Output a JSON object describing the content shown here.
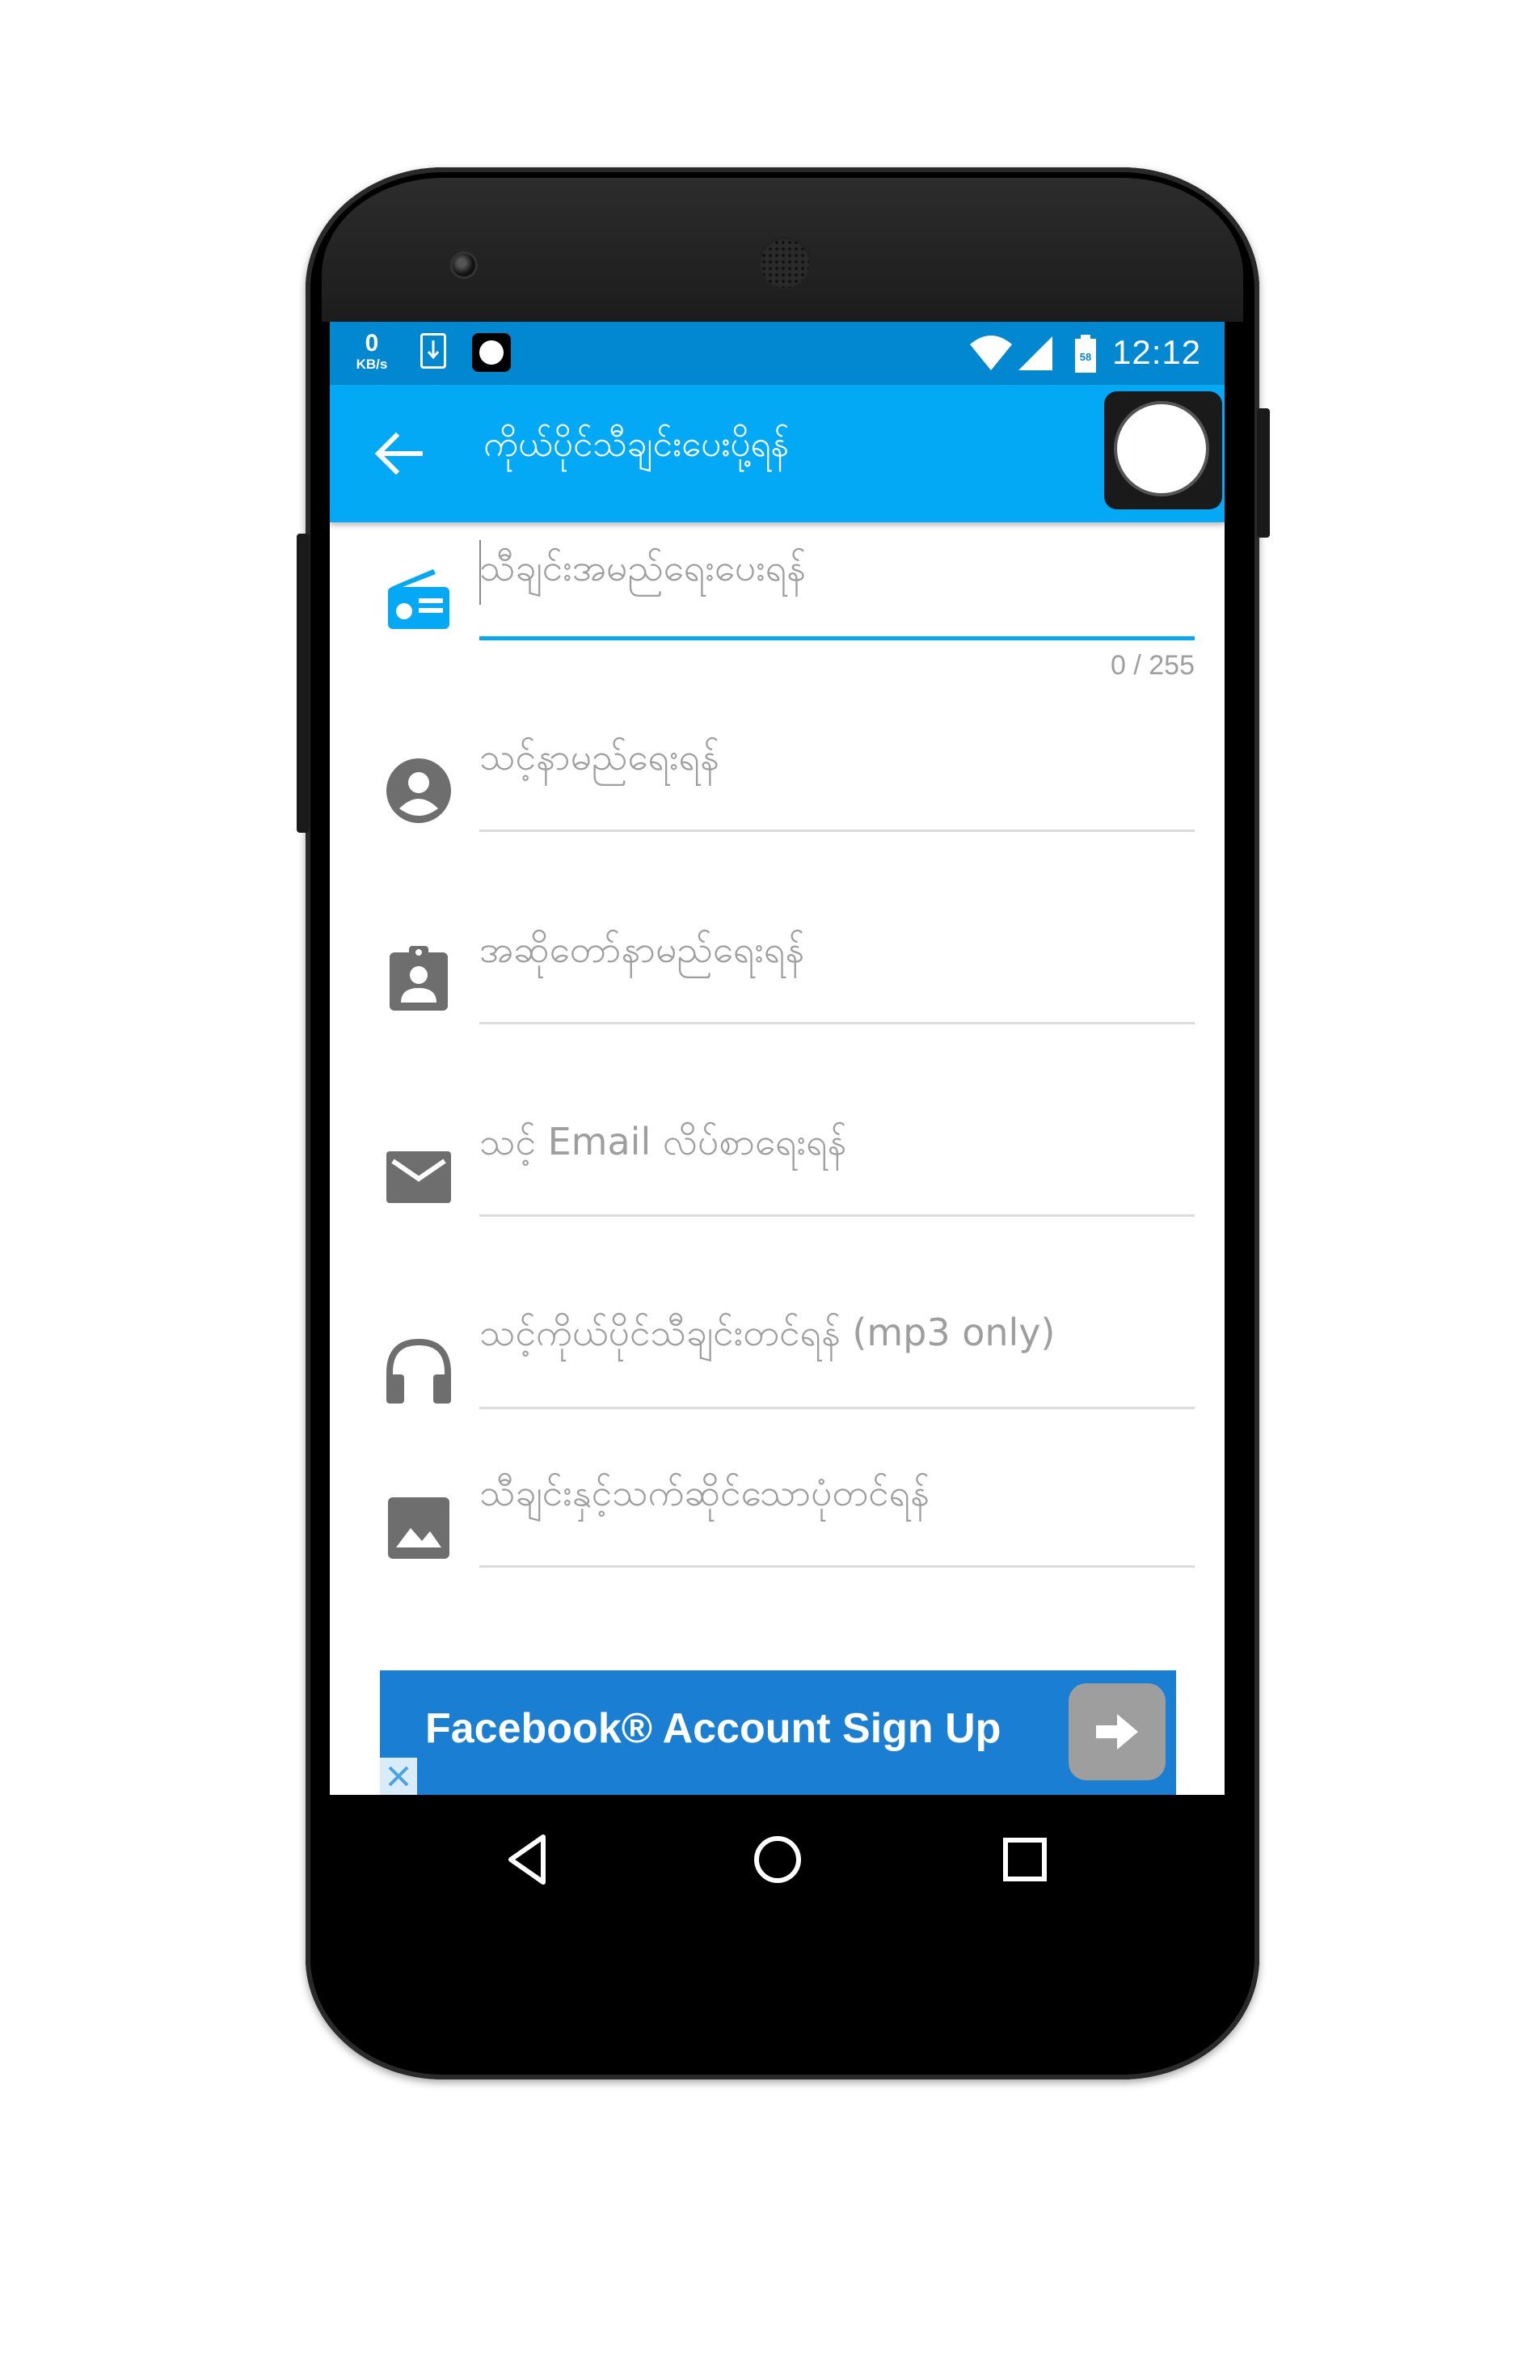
{
  "status_bar": {
    "net_speed": "0",
    "net_unit": "KB/s",
    "battery_level": "58",
    "time": "12:12"
  },
  "app_bar": {
    "title": "ကိုယ်ပိုင်သီချင်းပေးပို့ရန်"
  },
  "form": {
    "song_name": {
      "placeholder": "သီချင်းအမည်ရေးပေးရန်",
      "counter": "0 / 255"
    },
    "your_name": {
      "placeholder": "သင့်နာမည်ရေးရန်"
    },
    "singer_name": {
      "placeholder": "အဆိုတော်နာမည်ရေးရန်"
    },
    "email": {
      "placeholder": "သင့် Email လိပ်စာရေးရန်"
    },
    "song_upload": {
      "placeholder": "သင့်ကိုယ်ပိုင်သီချင်းတင်ရန် (mp3 only)"
    },
    "image_upload": {
      "placeholder": "သီချင်းနှင့်သက်ဆိုင်သောပုံတင်ရန်"
    }
  },
  "ad": {
    "text": "Facebook® Account Sign Up"
  },
  "icons": {
    "back": "arrow-back-icon",
    "radio": "radio-icon",
    "person": "account-circle-icon",
    "singer": "assignment-ind-icon",
    "email": "mail-icon",
    "headset": "headset-icon",
    "image": "image-icon"
  },
  "colors": {
    "status_bar": "#0288d1",
    "app_bar": "#03a9f4",
    "accent": "#03a9f4",
    "icon_gray": "#6e6e6e",
    "ad_blue": "#1a7ed3"
  }
}
